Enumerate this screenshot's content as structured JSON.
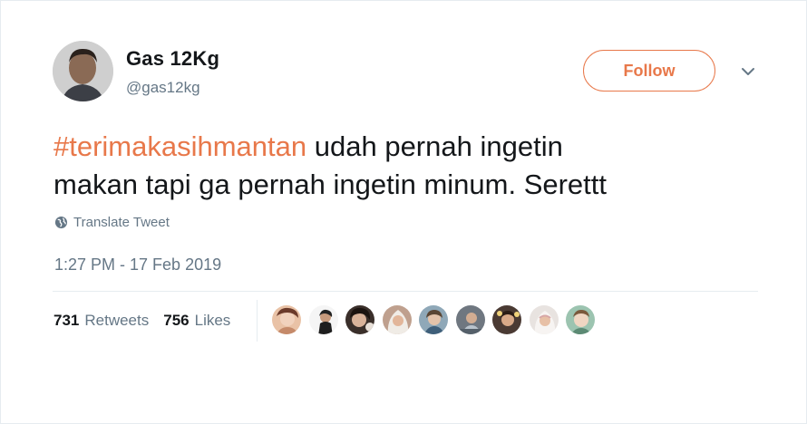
{
  "user": {
    "display_name": "Gas 12Kg",
    "handle": "@gas12kg"
  },
  "follow_label": "Follow",
  "tweet": {
    "hashtag": "#terimakasihmantan",
    "body_line1": " udah pernah ingetin",
    "body_line2": "makan tapi ga pernah ingetin minum. Serettt"
  },
  "translate_label": "Translate Tweet",
  "timestamp": "1:27 PM - 17 Feb 2019",
  "stats": {
    "retweets_count": "731",
    "retweets_label": "Retweets",
    "likes_count": "756",
    "likes_label": "Likes"
  },
  "colors": {
    "accent": "#e8784a",
    "text": "#14171a",
    "muted": "#657786",
    "divider": "#e6ecf0"
  },
  "icons": {
    "caret": "chevron-down-icon",
    "translate": "globe-icon"
  }
}
